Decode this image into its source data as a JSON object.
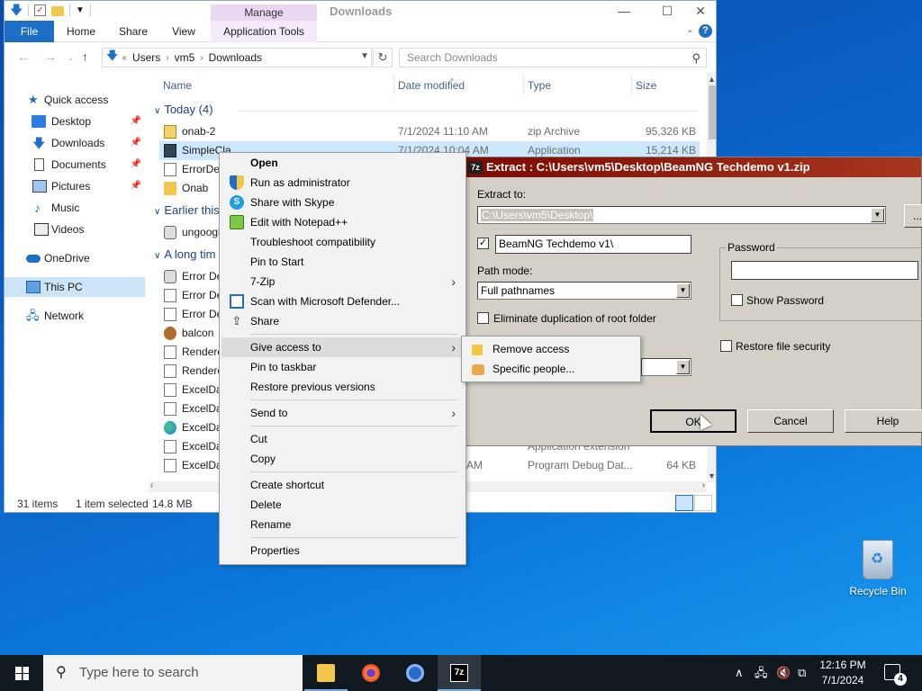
{
  "explorer": {
    "title": "Downloads",
    "contextual_tab_group": "Manage",
    "ribbon_tabs": [
      "File",
      "Home",
      "Share",
      "View",
      "Application Tools"
    ],
    "address": {
      "overflow": "«",
      "crumbs": [
        "Users",
        "vm5",
        "Downloads"
      ]
    },
    "search_placeholder": "Search Downloads",
    "sidebar": [
      {
        "label": "Quick access",
        "icon": "star-icon"
      },
      {
        "label": "Desktop",
        "icon": "desktop-icon",
        "pinned": true
      },
      {
        "label": "Downloads",
        "icon": "download-icon",
        "pinned": true
      },
      {
        "label": "Documents",
        "icon": "document-icon",
        "pinned": true
      },
      {
        "label": "Pictures",
        "icon": "pictures-icon",
        "pinned": true
      },
      {
        "label": "Music",
        "icon": "music-icon"
      },
      {
        "label": "Videos",
        "icon": "videos-icon"
      },
      {
        "label": "OneDrive",
        "icon": "cloud-icon"
      },
      {
        "label": "This PC",
        "icon": "computer-icon",
        "selected": true
      },
      {
        "label": "Network",
        "icon": "network-icon"
      }
    ],
    "columns": [
      "Name",
      "Date modified",
      "Type",
      "Size"
    ],
    "groups": [
      "Today (4)",
      "Earlier this",
      "A long tim"
    ],
    "files_today": [
      {
        "name": "onab-2",
        "date": "7/1/2024 11:10 AM",
        "type": "zip Archive",
        "size": "95,326 KB"
      },
      {
        "name": "SimpleCla",
        "date": "7/1/2024 10:04 AM",
        "type": "Application",
        "size": "15,214 KB"
      },
      {
        "name": "ErrorDes",
        "date": "",
        "type": "",
        "size": ""
      },
      {
        "name": "Onab",
        "date": "",
        "type": "",
        "size": ""
      }
    ],
    "files_earlier": [
      {
        "name": "ungoogle"
      }
    ],
    "files_long_ago": [
      {
        "name": "Error Des"
      },
      {
        "name": "Error Des"
      },
      {
        "name": "Error Des"
      },
      {
        "name": "balcon"
      },
      {
        "name": "Rendere"
      },
      {
        "name": "Rendere"
      },
      {
        "name": "ExcelDat"
      },
      {
        "name": "ExcelDat"
      },
      {
        "name": "ExcelDat",
        "type": "Application extension"
      },
      {
        "name": "ExcelDat",
        "date": "AM",
        "type": "Program Debug Dat...",
        "size": "64 KB"
      }
    ],
    "status": {
      "items": "31 items",
      "selected": "1 item selected",
      "size": "14.8 MB"
    }
  },
  "context_menu": {
    "items": [
      {
        "label": "Open",
        "bold": true
      },
      {
        "label": "Run as administrator",
        "icon": "uac-shield-icon"
      },
      {
        "label": "Share with Skype",
        "icon": "skype-icon"
      },
      {
        "label": "Edit with Notepad++",
        "icon": "notepadpp-icon"
      },
      {
        "label": "Troubleshoot compatibility"
      },
      {
        "label": "Pin to Start"
      },
      {
        "label": "7-Zip",
        "submenu": true
      },
      {
        "label": "Scan with Microsoft Defender...",
        "icon": "defender-icon"
      },
      {
        "label": "Share",
        "icon": "share-icon"
      },
      {
        "label": "Give access to",
        "submenu": true,
        "highlighted": true
      },
      {
        "label": "Pin to taskbar"
      },
      {
        "label": "Restore previous versions"
      },
      {
        "label": "Send to",
        "submenu": true
      },
      {
        "label": "Cut"
      },
      {
        "label": "Copy"
      },
      {
        "label": "Create shortcut"
      },
      {
        "label": "Delete"
      },
      {
        "label": "Rename"
      },
      {
        "label": "Properties"
      }
    ],
    "submenu_give_access": [
      {
        "label": "Remove access",
        "icon": "lock-icon"
      },
      {
        "label": "Specific people...",
        "icon": "people-icon"
      }
    ]
  },
  "extract_dialog": {
    "title": "Extract : C:\\Users\\vm5\\Desktop\\BeamNG Techdemo v1.zip",
    "extract_to_label": "Extract to:",
    "extract_to_value": "C:\\Users\\vm5\\Desktop\\",
    "browse_label": "...",
    "subfolder_checked": true,
    "subfolder_value": "BeamNG Techdemo v1\\",
    "path_mode_label": "Path mode:",
    "path_mode_value": "Full pathnames",
    "eliminate_dup_label": "Eliminate duplication of root folder",
    "eliminate_dup_checked": false,
    "password_label": "Password",
    "password_value": "",
    "show_password_label": "Show Password",
    "show_password_checked": false,
    "restore_security_label": "Restore file security",
    "restore_security_checked": false,
    "buttons": {
      "ok": "OK",
      "cancel": "Cancel",
      "help": "Help"
    }
  },
  "desktop": {
    "recycle_bin_label": "Recycle Bin"
  },
  "taskbar": {
    "search_placeholder": "Type here to search",
    "apps": [
      "File Explorer",
      "Firefox",
      "Chrome",
      "7-Zip"
    ],
    "time": "12:16 PM",
    "date": "7/1/2024",
    "notification_count": "4"
  },
  "colors": {
    "accent": "#1e6ec8",
    "extract_title_bg": "#7c0a02",
    "desktop_bg": "#0b63c9"
  }
}
